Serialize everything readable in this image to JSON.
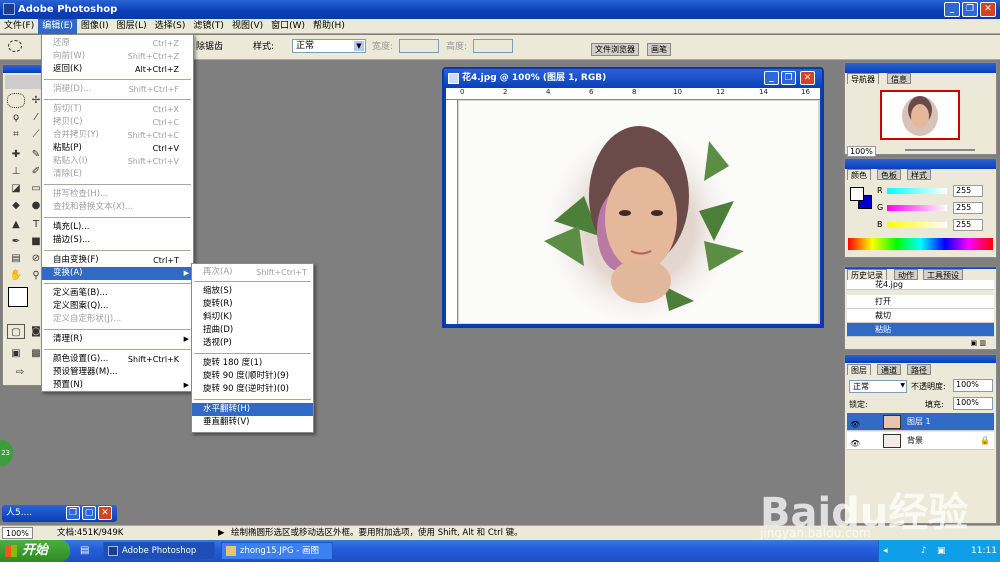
{
  "app": {
    "title": "Adobe Photoshop"
  },
  "menubar": [
    "文件(F)",
    "编辑(E)",
    "图像(I)",
    "图层(L)",
    "选择(S)",
    "滤镜(T)",
    "视图(V)",
    "窗口(W)",
    "帮助(H)"
  ],
  "options": {
    "feather_remove": "除锯齿",
    "style_label": "样式:",
    "style_value": "正常",
    "width_label": "宽度:",
    "height_label": "高度:",
    "tab_browser": "文件浏览器",
    "tab_brushes": "画笔"
  },
  "edit_menu": [
    {
      "label": "还原",
      "shortcut": "Ctrl+Z",
      "disabled": true
    },
    {
      "label": "向前(W)",
      "shortcut": "Shift+Ctrl+Z",
      "disabled": true
    },
    {
      "label": "返回(K)",
      "shortcut": "Alt+Ctrl+Z",
      "disabled": false
    },
    {
      "label": "消褪(D)...",
      "shortcut": "Shift+Ctrl+F",
      "disabled": true
    },
    {
      "label": "剪切(T)",
      "shortcut": "Ctrl+X",
      "disabled": true
    },
    {
      "label": "拷贝(C)",
      "shortcut": "Ctrl+C",
      "disabled": true
    },
    {
      "label": "合并拷贝(Y)",
      "shortcut": "Shift+Ctrl+C",
      "disabled": true
    },
    {
      "label": "粘贴(P)",
      "shortcut": "Ctrl+V",
      "disabled": false
    },
    {
      "label": "粘贴入(I)",
      "shortcut": "Shift+Ctrl+V",
      "disabled": true
    },
    {
      "label": "清除(E)",
      "shortcut": "",
      "disabled": true
    },
    {
      "label": "拼写检查(H)...",
      "shortcut": "",
      "disabled": true
    },
    {
      "label": "查找和替换文本(X)...",
      "shortcut": "",
      "disabled": true
    },
    {
      "label": "填充(L)...",
      "shortcut": "",
      "disabled": false
    },
    {
      "label": "描边(S)...",
      "shortcut": "",
      "disabled": false
    },
    {
      "label": "自由变换(F)",
      "shortcut": "Ctrl+T",
      "disabled": false
    },
    {
      "label": "变换(A)",
      "shortcut": "",
      "disabled": false,
      "highlight": true
    },
    {
      "label": "定义画笔(B)...",
      "shortcut": "",
      "disabled": false
    },
    {
      "label": "定义图案(Q)...",
      "shortcut": "",
      "disabled": false
    },
    {
      "label": "定义自定形状(J)...",
      "shortcut": "",
      "disabled": true
    },
    {
      "label": "清理(R)",
      "shortcut": "",
      "disabled": false
    },
    {
      "label": "颜色设置(G)...",
      "shortcut": "Shift+Ctrl+K",
      "disabled": false
    },
    {
      "label": "预设管理器(M)...",
      "shortcut": "",
      "disabled": false
    },
    {
      "label": "预置(N)",
      "shortcut": "",
      "disabled": false
    }
  ],
  "transform_menu": [
    {
      "label": "再次(A)",
      "shortcut": "Shift+Ctrl+T",
      "disabled": true
    },
    {
      "label": "缩放(S)",
      "shortcut": ""
    },
    {
      "label": "旋转(R)",
      "shortcut": ""
    },
    {
      "label": "斜切(K)",
      "shortcut": ""
    },
    {
      "label": "扭曲(D)",
      "shortcut": ""
    },
    {
      "label": "透视(P)",
      "shortcut": ""
    },
    {
      "label": "旋转 180 度(1)",
      "shortcut": ""
    },
    {
      "label": "旋转 90 度(顺时针)(9)",
      "shortcut": ""
    },
    {
      "label": "旋转 90 度(逆时针)(0)",
      "shortcut": ""
    },
    {
      "label": "水平翻转(H)",
      "shortcut": "",
      "highlight": true
    },
    {
      "label": "垂直翻转(V)",
      "shortcut": ""
    }
  ],
  "document": {
    "title": "花4.jpg @ 100% (图层 1, RGB)",
    "ruler": [
      "0",
      "2",
      "4",
      "6",
      "8",
      "10",
      "12",
      "14",
      "16"
    ]
  },
  "navigator": {
    "tabs": [
      "导航器",
      "信息"
    ],
    "zoom": "100%"
  },
  "color": {
    "tabs": [
      "颜色",
      "色板",
      "样式"
    ],
    "r_label": "R",
    "g_label": "G",
    "b_label": "B",
    "r": "255",
    "g": "255",
    "b": "255",
    "fg": "#ffffff",
    "bg": "#0000c8"
  },
  "history": {
    "tabs": [
      "历史记录",
      "动作",
      "工具预设"
    ],
    "items": [
      "花4.jpg",
      "打开",
      "裁切",
      "粘贴"
    ]
  },
  "layers": {
    "tabs": [
      "图层",
      "通道",
      "路径"
    ],
    "blend": "正常",
    "opacity_label": "不透明度:",
    "opacity": "100%",
    "lock_label": "锁定:",
    "fill_label": "填充:",
    "fill": "100%",
    "items": [
      "图层 1",
      "背景"
    ]
  },
  "minimized_doc": {
    "title": "人5...."
  },
  "status": {
    "zoom": "100%",
    "doc": "文档:451K/949K",
    "hint": "绘制椭圆形选区或移动选区外框。要用附加选项，使用 Shift, Alt 和 Ctrl 键。"
  },
  "badge": "23",
  "taskbar": {
    "start": "开始",
    "tasks": [
      "Adobe Photoshop",
      "zhong15.JPG - 画图"
    ],
    "clock": "11:11"
  },
  "watermark": {
    "brand": "Baidu经验",
    "url": "jingyan.baidu.com"
  }
}
